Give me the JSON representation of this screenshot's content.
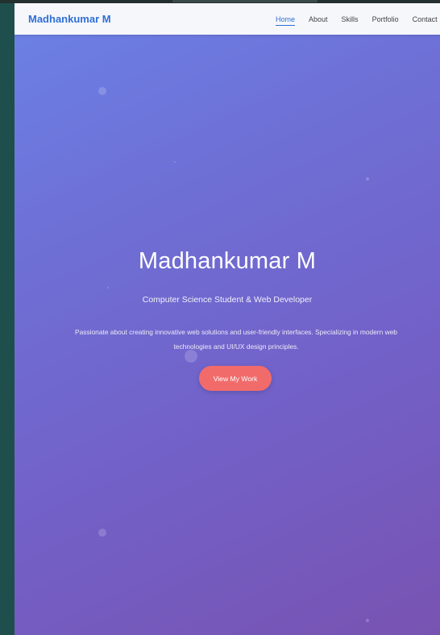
{
  "nav": {
    "brand": "Madhankumar M",
    "links": [
      "Home",
      "About",
      "Skills",
      "Portfolio",
      "Contact"
    ],
    "active": "Home"
  },
  "hero": {
    "title": "Madhankumar M",
    "subtitle": "Computer Science Student & Web Developer",
    "description": "Passionate about creating innovative web solutions and user-friendly interfaces. Specializing in modern web technologies and UI/UX design principles.",
    "cta_label": "View My Work"
  },
  "colors": {
    "brand": "#2f6fd6",
    "cta": "#f26b6b",
    "gradient_start": "#6b82e6",
    "gradient_end": "#7853b2"
  }
}
